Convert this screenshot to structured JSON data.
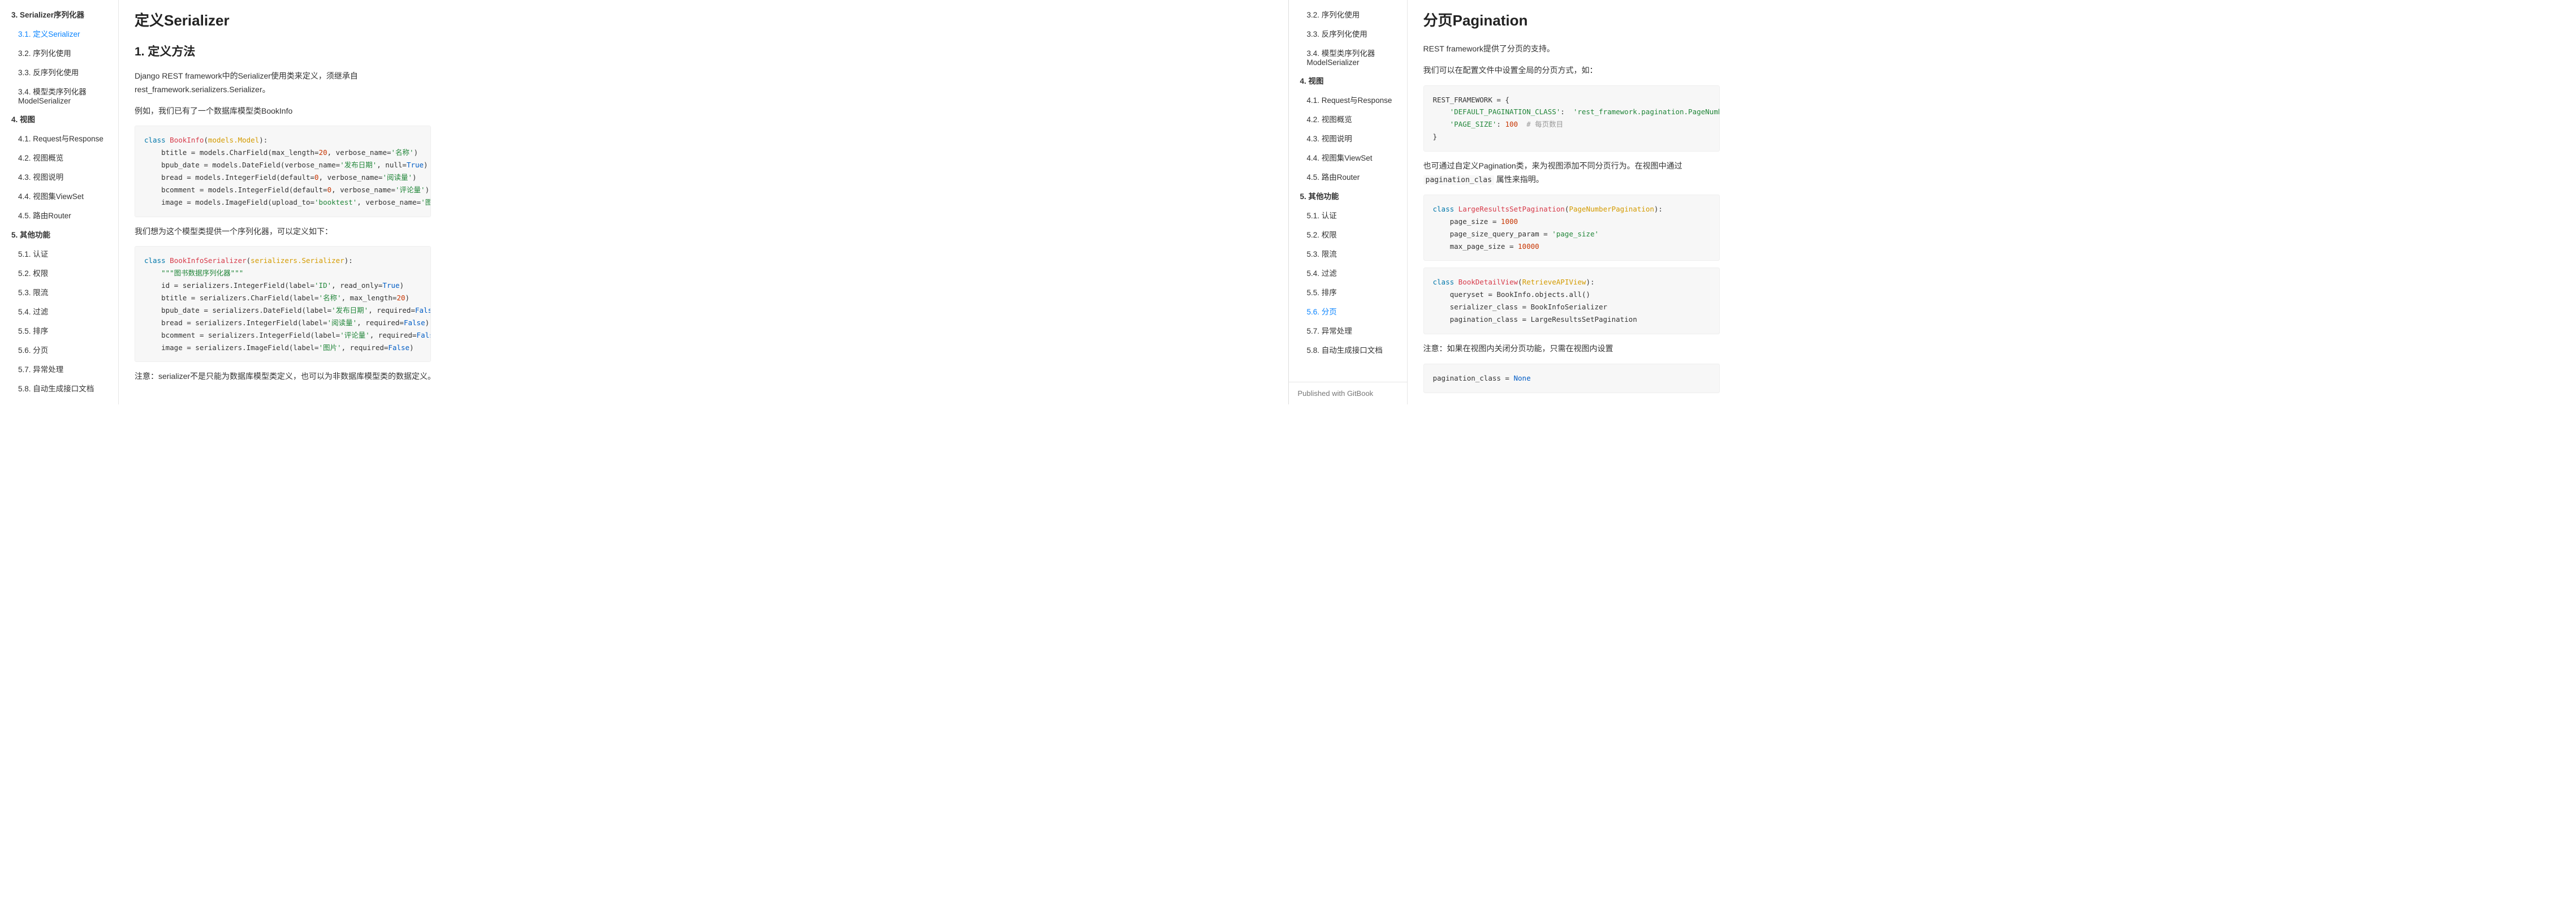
{
  "left": {
    "nav": [
      {
        "t": "3. Serializer序列化器",
        "b": true
      },
      {
        "t": "3.1. 定义Serializer",
        "sub": true,
        "active": true
      },
      {
        "t": "3.2. 序列化使用",
        "sub": true
      },
      {
        "t": "3.3. 反序列化使用",
        "sub": true
      },
      {
        "t": "3.4. 模型类序列化器ModelSerializer",
        "sub": true
      },
      {
        "t": "4. 视图",
        "b": true
      },
      {
        "t": "4.1. Request与Response",
        "sub": true
      },
      {
        "t": "4.2. 视图概览",
        "sub": true
      },
      {
        "t": "4.3. 视图说明",
        "sub": true
      },
      {
        "t": "4.4. 视图集ViewSet",
        "sub": true
      },
      {
        "t": "4.5. 路由Router",
        "sub": true
      },
      {
        "t": "5. 其他功能",
        "b": true
      },
      {
        "t": "5.1. 认证",
        "sub": true
      },
      {
        "t": "5.2. 权限",
        "sub": true
      },
      {
        "t": "5.3. 限流",
        "sub": true
      },
      {
        "t": "5.4. 过滤",
        "sub": true
      },
      {
        "t": "5.5. 排序",
        "sub": true
      },
      {
        "t": "5.6. 分页",
        "sub": true
      },
      {
        "t": "5.7. 异常处理",
        "sub": true
      },
      {
        "t": "5.8. 自动生成接口文档",
        "sub": true
      }
    ],
    "h1": "定义Serializer",
    "h2": "1. 定义方法",
    "p1": "Django REST framework中的Serializer使用类来定义，须继承自rest_framework.serializers.Serializer。",
    "p2": "例如，我们已有了一个数据库模型类BookInfo",
    "p3": "我们想为这个模型类提供一个序列化器，可以定义如下：",
    "p4": "注意：serializer不是只能为数据库模型类定义，也可以为非数据库模型类的数据定义。serializer是独立于数"
  },
  "right": {
    "nav": [
      {
        "t": "3.2. 序列化使用",
        "sub": true
      },
      {
        "t": "3.3. 反序列化使用",
        "sub": true
      },
      {
        "t": "3.4. 模型类序列化器ModelSerializer",
        "sub": true
      },
      {
        "t": "4. 视图",
        "b": true
      },
      {
        "t": "4.1. Request与Response",
        "sub": true
      },
      {
        "t": "4.2. 视图概览",
        "sub": true
      },
      {
        "t": "4.3. 视图说明",
        "sub": true
      },
      {
        "t": "4.4. 视图集ViewSet",
        "sub": true
      },
      {
        "t": "4.5. 路由Router",
        "sub": true
      },
      {
        "t": "5. 其他功能",
        "b": true
      },
      {
        "t": "5.1. 认证",
        "sub": true
      },
      {
        "t": "5.2. 权限",
        "sub": true
      },
      {
        "t": "5.3. 限流",
        "sub": true
      },
      {
        "t": "5.4. 过滤",
        "sub": true
      },
      {
        "t": "5.5. 排序",
        "sub": true
      },
      {
        "t": "5.6. 分页",
        "sub": true,
        "active": true
      },
      {
        "t": "5.7. 异常处理",
        "sub": true
      },
      {
        "t": "5.8. 自动生成接口文档",
        "sub": true
      }
    ],
    "footer": "Published with GitBook",
    "h1": "分页Pagination",
    "p1": "REST framework提供了分页的支持。",
    "p2": "我们可以在配置文件中设置全局的分页方式，如：",
    "p3a": "也可通过自定义Pagination类，来为视图添加不同分页行为。在视图中通过 ",
    "p3code": "pagination_clas",
    "p3b": " 属性来指明。",
    "p4": "注意：如果在视图内关闭分页功能，只需在视图内设置"
  }
}
